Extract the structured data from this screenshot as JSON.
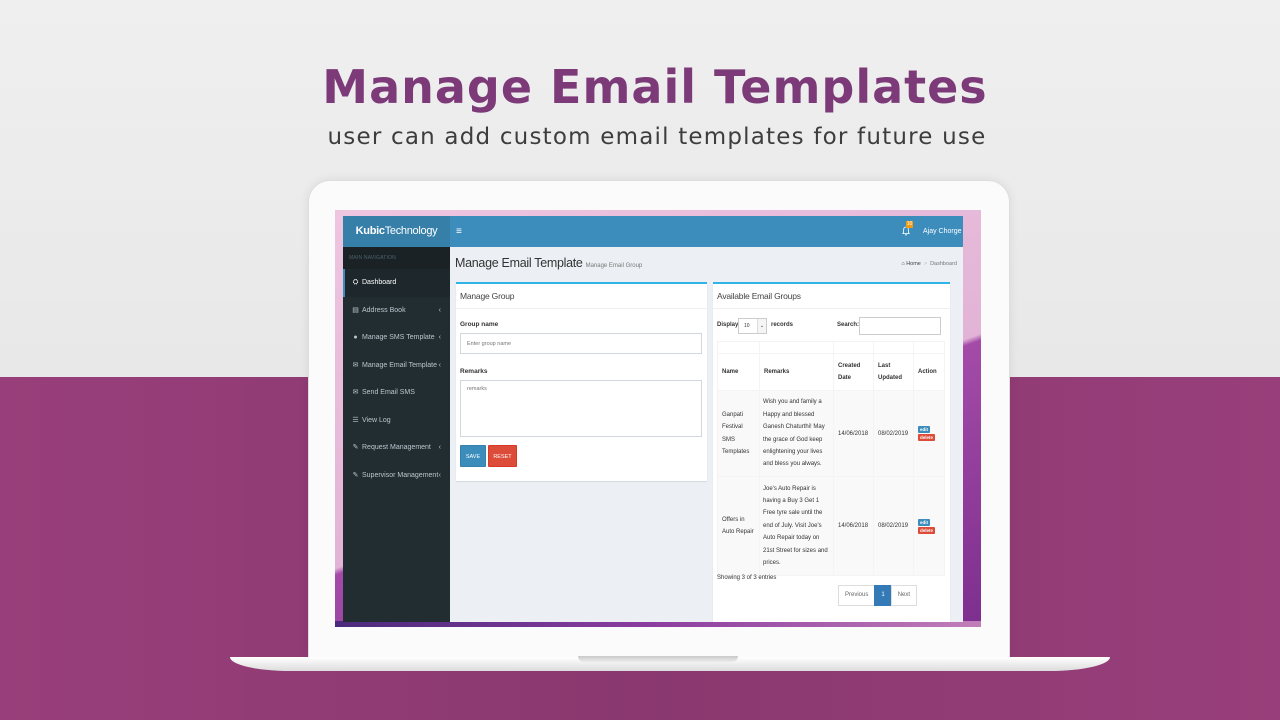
{
  "hero": {
    "title": "Manage Email Templates",
    "subtitle": "user can add custom email templates for future use"
  },
  "colors": {
    "brand_purple": "#7d3a78",
    "header_blue": "#3c8dbc",
    "sidebar_dark": "#222d32",
    "danger_red": "#dd4b39",
    "box_border": "#2fb4e8"
  },
  "app": {
    "logo_bold": "Kubic",
    "logo_rest": "Technology",
    "menu_toggle_icon": "≡",
    "notification_count": "10",
    "user_name": "Ajay Chorge"
  },
  "sidebar": {
    "header": "MAIN NAVIGATION",
    "items": [
      {
        "label": "Dashboard",
        "icon": "dashboard-icon",
        "glyph": "⛭",
        "has_children": false,
        "active": true
      },
      {
        "label": "Address Book",
        "icon": "book-icon",
        "glyph": "▤",
        "has_children": true
      },
      {
        "label": "Manage SMS Template",
        "icon": "comment-icon",
        "glyph": "●",
        "has_children": true
      },
      {
        "label": "Manage Email Template",
        "icon": "envelope-outline-icon",
        "glyph": "✉",
        "has_children": true
      },
      {
        "label": "Send Email SMS",
        "icon": "envelope-icon",
        "glyph": "✉",
        "has_children": false
      },
      {
        "label": "View Log",
        "icon": "list-icon",
        "glyph": "☰",
        "has_children": false
      },
      {
        "label": "Request Management",
        "icon": "edit-icon",
        "glyph": "✎",
        "has_children": true
      },
      {
        "label": "Supervisor Management",
        "icon": "edit-icon",
        "glyph": "✎",
        "has_children": true
      }
    ],
    "chevron": "‹"
  },
  "page": {
    "title": "Manage Email Template",
    "subtitle": "Manage Email Group",
    "breadcrumb": {
      "home": "Home",
      "separator": ">",
      "current": "Dashboard"
    }
  },
  "manage_group": {
    "title": "Manage Group",
    "group_name_label": "Group name",
    "group_name_placeholder": "Enter group name",
    "group_name_value": "",
    "remarks_label": "Remarks",
    "remarks_placeholder": "remarks",
    "remarks_value": "",
    "save_label": "SAVE",
    "reset_label": "RESET"
  },
  "groups_table": {
    "title": "Available Email Groups",
    "display_label": "Display",
    "page_size": "10",
    "records_label": "records",
    "search_label": "Search:",
    "search_value": "",
    "columns": [
      "Name",
      "Remarks",
      "Created Date",
      "Last Updated",
      "Action"
    ],
    "rows": [
      {
        "name": "Ganpati Festival SMS Templates",
        "remarks": "Wish you and family a Happy and blessed Ganesh Chaturthi! May the grace of God keep enlightening your lives and bless you always.",
        "created": "14/06/2018",
        "updated": "08/02/2019",
        "edit": "edit",
        "delete": "delete"
      },
      {
        "name": "Offers in Auto Repair",
        "remarks": "Joe's Auto Repair is having a Buy 3 Get 1 Free tyre sale until the end of July. Visit Joe's Auto Repair today on 21st Street for sizes and prices.",
        "created": "14/06/2018",
        "updated": "08/02/2019",
        "edit": "edit",
        "delete": "delete"
      }
    ],
    "info": "Showing 3 of 3 entries",
    "pagination": {
      "previous": "Previous",
      "current": "1",
      "next": "Next"
    }
  }
}
